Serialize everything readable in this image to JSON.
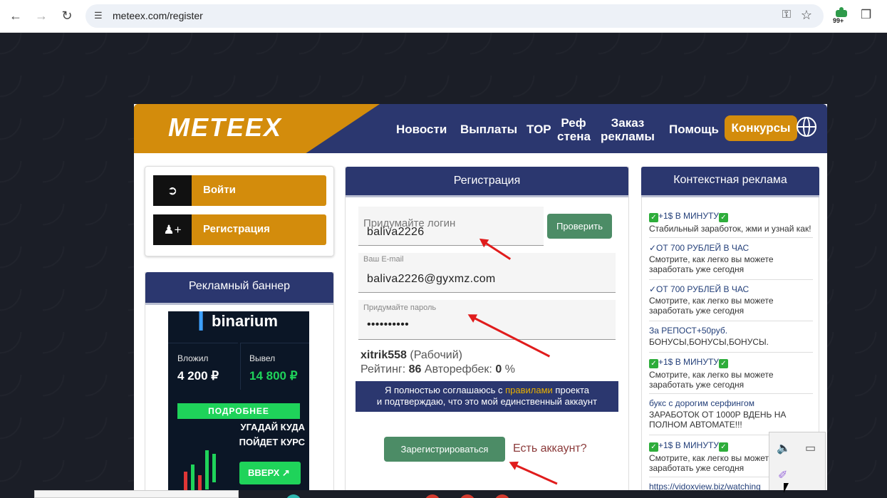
{
  "browser": {
    "url": "meteex.com/register",
    "extension_badge": "99+"
  },
  "site": {
    "logo": "METEEX",
    "menu": [
      "Новости",
      "Выплаты",
      "TOP",
      "Реф стена",
      "Заказ рекламы",
      "Помощь"
    ],
    "menu_ref_line1": "Реф",
    "menu_ref_line2": "стена",
    "menu_order_line1": "Заказ",
    "menu_order_line2": "рекламы",
    "menu_active": "Конкурсы"
  },
  "auth": {
    "login": "Войти",
    "register": "Регистрация"
  },
  "banner": {
    "title": "Рекламный баннер",
    "brand": "binarium",
    "deposit_label": "Вложил",
    "deposit_value": "4 200 ₽",
    "withdraw_label": "Вывел",
    "withdraw_value": "14 800 ₽",
    "more": "ПОДРОБНЕЕ",
    "guess_line1": "УГАДАЙ КУДА",
    "guess_line2": "ПОЙДЕТ КУРС",
    "up": "ВВЕРХ"
  },
  "registration": {
    "title": "Регистрация",
    "login_placeholder": "Придумайте логин",
    "login_value": "baliva2226",
    "check_button": "Проверить",
    "email_label": "Ваш E-mail",
    "email_value": "baliva2226@gyxmz.com",
    "password_label": "Придумайте пароль",
    "password_value": "••••••••••",
    "referrer_name": "xitrik558",
    "referrer_status": "(Рабочий)",
    "rating_label": "Рейтинг:",
    "rating_value": "86",
    "refback_label": "Авторефбек:",
    "refback_value": "0",
    "refback_unit": "%",
    "agree_part1": "Я полностью соглашаюсь с",
    "agree_link": "правилами",
    "agree_part2": "проекта",
    "agree_line2": "и подтверждаю, что это мой единственный аккаунт",
    "submit": "Зарегистрироваться",
    "have_account": "Есть аккаунт?"
  },
  "ads": {
    "title": "Контекстная реклама",
    "items": [
      {
        "title": "+1$ В МИНУТУ",
        "desc": "Стабильный заработок, жми и узнай как!",
        "checks": true
      },
      {
        "title": "✓ОТ 700 РУБЛЕЙ В ЧАС",
        "desc": "Смотрите, как легко вы можете заработать уже сегодня",
        "checks": false
      },
      {
        "title": "✓ОТ 700 РУБЛЕЙ В ЧАС",
        "desc": "Смотрите, как легко вы можете заработать уже сегодня",
        "checks": false
      },
      {
        "title": "За РЕПОСТ+50руб.",
        "desc": "БОНУСЫ,БОНУСЫ,БОНУСЫ.",
        "checks": false
      },
      {
        "title": "+1$ В МИНУТУ",
        "desc": "Смотрите, как легко вы можете заработать уже сегодня",
        "checks": true
      },
      {
        "title": "букс с дорогим серфингом",
        "desc": "ЗАРАБОТОК ОТ 1000Р ВДЕНЬ НА ПОЛНОМ АВТОМАТЕ!!!",
        "checks": false
      },
      {
        "title": "+1$ В МИНУТУ",
        "desc": "Смотрите, как легко вы можете заработать уже сегодня",
        "checks": true
      },
      {
        "title": "https://vidoxview.biz/watching",
        "desc": "",
        "checks": false
      }
    ]
  },
  "colors": {
    "header_bg": "#2b376f",
    "accent_orange": "#d38c0c",
    "button_green": "#4c8c66",
    "page_bg": "#1b1e27"
  }
}
